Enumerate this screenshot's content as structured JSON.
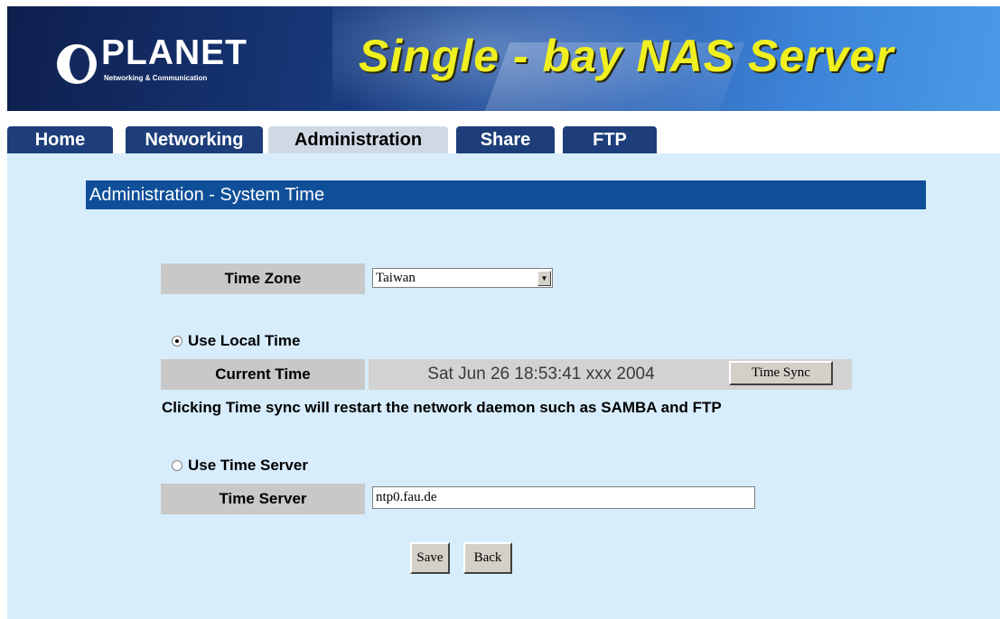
{
  "header": {
    "logo_text": "PLANET",
    "logo_subtext": "Networking & Communication",
    "title": "Single - bay NAS Server"
  },
  "tabs": [
    {
      "label": "Home",
      "active": false
    },
    {
      "label": "Networking",
      "active": false
    },
    {
      "label": "Administration",
      "active": true
    },
    {
      "label": "Share",
      "active": false
    },
    {
      "label": "FTP",
      "active": false
    }
  ],
  "section_title": "Administration - System Time",
  "time_zone": {
    "label": "Time Zone",
    "selected": "Taiwan"
  },
  "local_time": {
    "radio_label": "Use Local Time",
    "selected": true,
    "current_time_label": "Current Time",
    "current_time_value": "Sat Jun 26 18:53:41 xxx 2004",
    "sync_button": "Time Sync",
    "note": "Clicking Time sync will restart the network daemon such as SAMBA and FTP"
  },
  "time_server": {
    "radio_label": "Use Time Server",
    "selected": false,
    "label": "Time Server",
    "value": "ntp0.fau.de"
  },
  "actions": {
    "save": "Save",
    "back": "Back"
  },
  "colors": {
    "tab_bg": "#1d3e7a",
    "tab_active_bg": "#cfd9e4",
    "panel_bg": "#d7edfc",
    "section_bar": "#0f4f99",
    "banner_title": "#f0f020"
  }
}
